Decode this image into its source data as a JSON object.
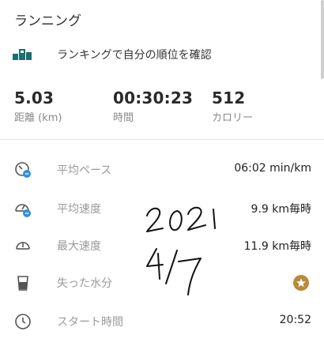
{
  "header": {
    "title": "ランニング"
  },
  "ranking": {
    "label": "ランキングで自分の順位を確認"
  },
  "stats": [
    {
      "value": "5.03",
      "label": "距離 (km)"
    },
    {
      "value": "00:30:23",
      "label": "時間"
    },
    {
      "value": "512",
      "label": "カロリー"
    }
  ],
  "metrics": [
    {
      "label": "平均ペース",
      "value": "06:02 min/km",
      "icon": "pace-gauge-icon"
    },
    {
      "label": "平均速度",
      "value": "9.9 km毎時",
      "icon": "speed-gauge-icon"
    },
    {
      "label": "最大速度",
      "value": "11.9 km毎時",
      "icon": "max-speed-gauge-icon"
    },
    {
      "label": "失った水分",
      "value": "",
      "icon": "water-cup-icon"
    },
    {
      "label": "スタート時間",
      "value": "20:52",
      "icon": "clock-icon"
    }
  ],
  "handwriting": {
    "line1": "2021",
    "line2": "4/7"
  },
  "colors": {
    "accent": "#1a6f73",
    "badge": "#b88a3a",
    "blue": "#2f8fdc"
  }
}
